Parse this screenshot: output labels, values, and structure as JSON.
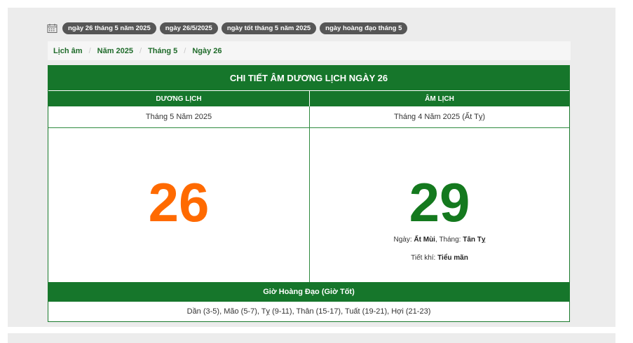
{
  "tags": [
    {
      "label": "ngày 26 tháng 5 năm 2025"
    },
    {
      "label": "ngày 26/5/2025"
    },
    {
      "label": "ngày tốt tháng 5 năm 2025"
    },
    {
      "label": "ngày hoàng đạo tháng 5"
    }
  ],
  "breadcrumb": [
    "Lịch âm",
    "Năm 2025",
    "Tháng 5",
    "Ngày 26"
  ],
  "breadcrumb_separator": "/",
  "card": {
    "title": "CHI TIẾT ÂM DƯƠNG LỊCH NGÀY 26",
    "solar_header": "DƯƠNG LỊCH",
    "lunar_header": "ÂM LỊCH",
    "solar_sub": "Tháng 5 Năm 2025",
    "lunar_sub": "Tháng 4 Năm 2025 (Ất Tỵ)",
    "solar_day": "26",
    "lunar_day": "29",
    "day_label": "Ngày:",
    "day_value": "Ất Mùi",
    "month_label": ", Tháng:",
    "month_value": "Tân Tỵ",
    "tietkhi_label": "Tiết khí:",
    "tietkhi_value": "Tiểu mãn",
    "hours_title": "Giờ Hoàng Đạo (Giờ Tốt)",
    "hours_list": "Dần (3-5), Mão (5-7), Tỵ (9-11), Thân (15-17), Tuất (19-21), Hợi (21-23)"
  },
  "colors": {
    "brand_green": "#16762b",
    "solar_orange": "#ff6a00",
    "lunar_green": "#14791e",
    "tag_gray": "#565656"
  },
  "icons": {
    "tagbar": "calendar-icon"
  }
}
